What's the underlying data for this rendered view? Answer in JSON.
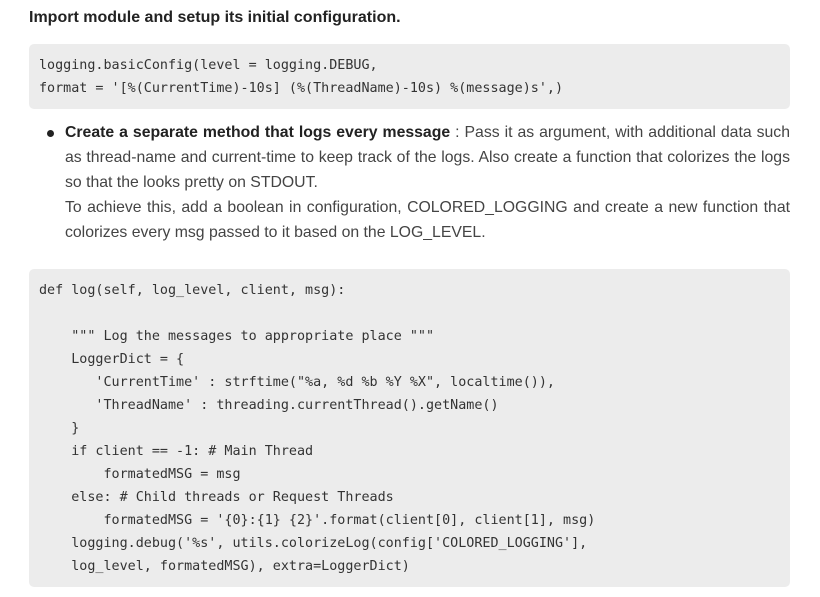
{
  "heading": "Import module and setup its initial configuration.",
  "code1": {
    "lines": [
      "logging.basicConfig(level = logging.DEBUG,",
      "format = '[%(CurrentTime)-10s] (%(ThreadName)-10s) %(message)s',)"
    ]
  },
  "bullet": {
    "bold_lead": "Create a separate method that logs every message",
    "text_1": " : Pass it as argument, with additional data such as thread-name and current-time to keep track of the logs. Also create a function that colorizes the logs so that the looks pretty on STDOUT.",
    "text_2": "To achieve this, add a boolean in configuration, COLORED_LOGGING and create a new function that colorizes every msg passed to it based on the LOG_LEVEL."
  },
  "code2": {
    "lines": [
      "def log(self, log_level, client, msg):",
      "",
      "    \"\"\" Log the messages to appropriate place \"\"\"",
      "    LoggerDict = {",
      "       'CurrentTime' : strftime(\"%a, %d %b %Y %X\", localtime()),",
      "       'ThreadName' : threading.currentThread().getName()",
      "    }",
      "    if client == -1: # Main Thread",
      "        formatedMSG = msg",
      "    else: # Child threads or Request Threads",
      "        formatedMSG = '{0}:{1} {2}'.format(client[0], client[1], msg)",
      "    logging.debug('%s', utils.colorizeLog(config['COLORED_LOGGING'],",
      "    log_level, formatedMSG), extra=LoggerDict)"
    ]
  }
}
